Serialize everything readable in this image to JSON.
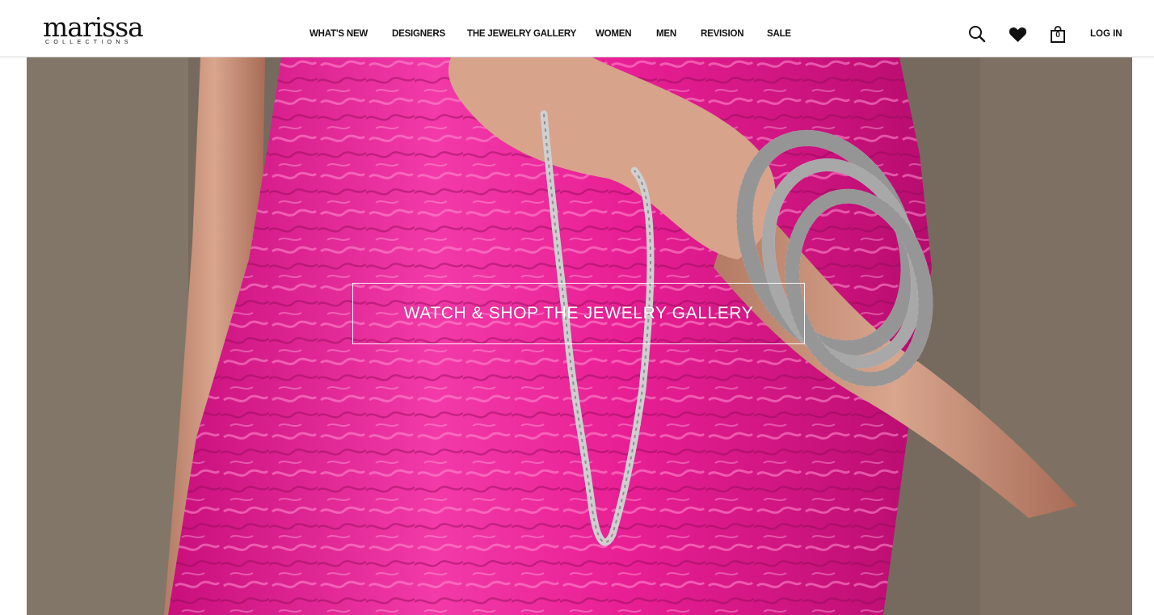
{
  "brand": {
    "name": "marissa",
    "tagline": "COLLECTIONS"
  },
  "nav": {
    "items": [
      {
        "label": "WHAT'S NEW"
      },
      {
        "label": "DESIGNERS"
      },
      {
        "label": "THE JEWELRY GALLERY"
      },
      {
        "label": "WOMEN"
      },
      {
        "label": "MEN"
      },
      {
        "label": "REVISION"
      },
      {
        "label": "SALE"
      }
    ]
  },
  "header_actions": {
    "search_icon": "search-icon",
    "wishlist_icon": "heart-icon",
    "cart_icon": "shopping-bag-icon",
    "cart_count": "0",
    "login_label": "LOG IN"
  },
  "hero": {
    "cta_label": "WATCH & SHOP  THE JEWELRY GALLERY",
    "accent_color": "#e8178f"
  }
}
